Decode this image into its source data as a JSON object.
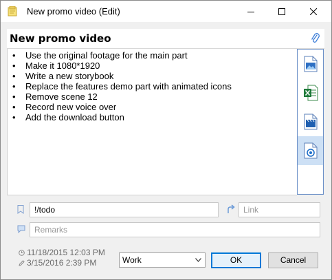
{
  "window": {
    "title": "New promo video (Edit)"
  },
  "note": {
    "title": "New promo video",
    "items": [
      "Use the original footage for the main part",
      "Make it 1080*1920",
      "Write a new storybook",
      "Replace the features demo part with animated icons",
      "Remove scene 12",
      "Record new voice over",
      "Add the download button"
    ]
  },
  "sidebar": {
    "attachments": [
      {
        "icon": "image-file-icon"
      },
      {
        "icon": "excel-file-icon"
      },
      {
        "icon": "video-file-icon"
      },
      {
        "icon": "audio-file-icon",
        "selected": true
      }
    ]
  },
  "fields": {
    "tags_value": "!/todo",
    "link_placeholder": "Link",
    "remarks_placeholder": "Remarks"
  },
  "dates": {
    "created": "11/18/2015 12:03 PM",
    "modified": "3/15/2016 2:39 PM"
  },
  "category": {
    "selected": "Work"
  },
  "buttons": {
    "ok": "OK",
    "cancel": "Cancel"
  },
  "colors": {
    "accent": "#0078d7",
    "selected_bg": "#cde0f5",
    "sidebar_border": "#6a8fc7"
  }
}
